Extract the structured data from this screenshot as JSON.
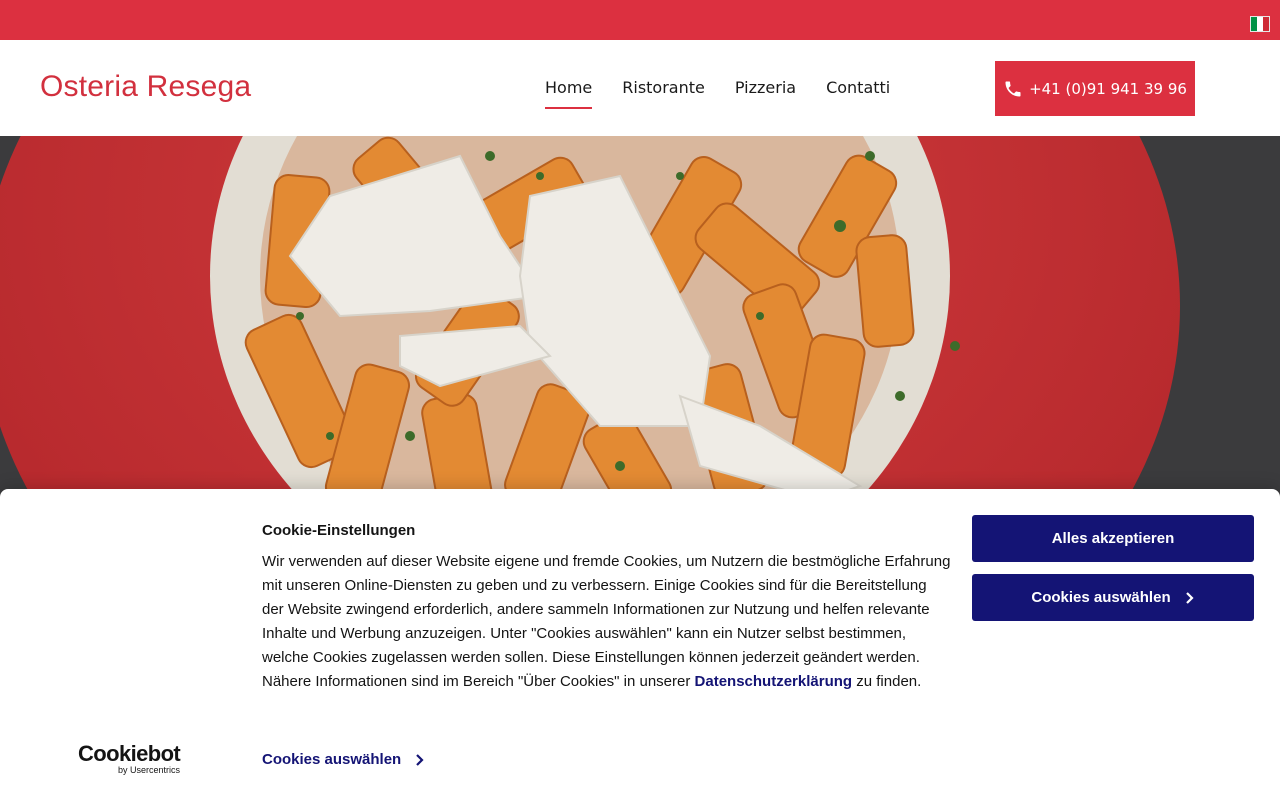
{
  "topbar": {
    "language_flag": "italian-flag-icon",
    "flag_colors": [
      "#009246",
      "#ffffff",
      "#ce2b37"
    ]
  },
  "header": {
    "logo": "Osteria Resega",
    "nav": [
      {
        "label": "Home",
        "active": true
      },
      {
        "label": "Ristorante",
        "active": false
      },
      {
        "label": "Pizzeria",
        "active": false
      },
      {
        "label": "Contatti",
        "active": false
      }
    ],
    "phone": {
      "icon": "phone-icon",
      "label": "+41 (0)91 941 39 96"
    }
  },
  "colors": {
    "brand_red": "#dc3040",
    "cookie_navy": "#141475"
  },
  "cookie_banner": {
    "title": "Cookie-Einstellungen",
    "text_before_link": "Wir verwenden auf dieser Website eigene und fremde Cookies, um Nutzern die bestmögliche Erfahrung mit unseren Online-Diensten zu geben und zu verbessern. Einige Cookies sind für die Bereitstellung der Website zwingend erforderlich, andere sammeln Informationen zur Nutzung und helfen relevante Inhalte und Werbung anzuzeigen. Unter \"Cookies auswählen\" kann ein Nutzer selbst bestimmen, welche Cookies zugelassen werden sollen. Diese Einstellungen können jederzeit geändert werden. Nähere Informationen sind im Bereich \"Über Cookies\" in unserer ",
    "link_text": "Datenschutzerklärung",
    "text_after_link": " zu finden.",
    "accept_all": "Alles akzeptieren",
    "select_cookies": "Cookies auswählen",
    "select_cookies_link": "Cookies auswählen",
    "chevron_icon": "chevron-right-icon",
    "branding": {
      "logo": "Cookiebot",
      "sub": "by Usercentrics"
    }
  }
}
